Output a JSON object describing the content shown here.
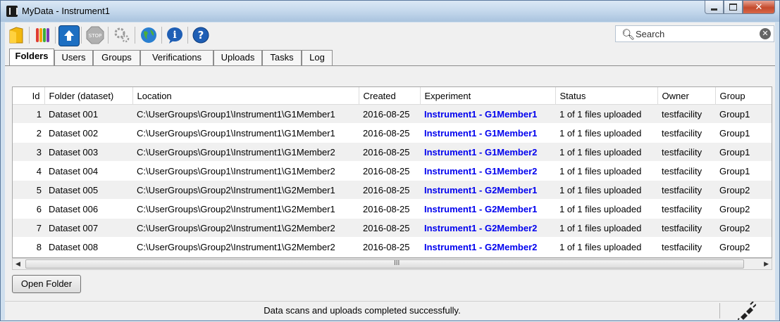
{
  "window": {
    "title": "MyData - Instrument1"
  },
  "toolbar": {
    "icons": [
      "folder-icon",
      "test-tubes-icon",
      "upload-icon",
      "stop-icon",
      "settings-gears-icon",
      "web-globe-icon",
      "info-icon",
      "help-icon"
    ],
    "search_placeholder": "Search"
  },
  "tabs": [
    {
      "label": "Folders",
      "active": true
    },
    {
      "label": "Users"
    },
    {
      "label": "Groups"
    },
    {
      "label": "Verifications"
    },
    {
      "label": "Uploads"
    },
    {
      "label": "Tasks"
    },
    {
      "label": "Log"
    }
  ],
  "table": {
    "columns": [
      "Id",
      "Folder (dataset)",
      "Location",
      "Created",
      "Experiment",
      "Status",
      "Owner",
      "Group"
    ],
    "rows": [
      [
        "1",
        "Dataset 001",
        "C:\\UserGroups\\Group1\\Instrument1\\G1Member1",
        "2016-08-25",
        "Instrument1 - G1Member1",
        "1 of 1 files uploaded",
        "testfacility",
        "Group1"
      ],
      [
        "2",
        "Dataset 002",
        "C:\\UserGroups\\Group1\\Instrument1\\G1Member1",
        "2016-08-25",
        "Instrument1 - G1Member1",
        "1 of 1 files uploaded",
        "testfacility",
        "Group1"
      ],
      [
        "3",
        "Dataset 003",
        "C:\\UserGroups\\Group1\\Instrument1\\G1Member2",
        "2016-08-25",
        "Instrument1 - G1Member2",
        "1 of 1 files uploaded",
        "testfacility",
        "Group1"
      ],
      [
        "4",
        "Dataset 004",
        "C:\\UserGroups\\Group1\\Instrument1\\G1Member2",
        "2016-08-25",
        "Instrument1 - G1Member2",
        "1 of 1 files uploaded",
        "testfacility",
        "Group1"
      ],
      [
        "5",
        "Dataset 005",
        "C:\\UserGroups\\Group2\\Instrument1\\G2Member1",
        "2016-08-25",
        "Instrument1 - G2Member1",
        "1 of 1 files uploaded",
        "testfacility",
        "Group2"
      ],
      [
        "6",
        "Dataset 006",
        "C:\\UserGroups\\Group2\\Instrument1\\G2Member1",
        "2016-08-25",
        "Instrument1 - G2Member1",
        "1 of 1 files uploaded",
        "testfacility",
        "Group2"
      ],
      [
        "7",
        "Dataset 007",
        "C:\\UserGroups\\Group2\\Instrument1\\G2Member2",
        "2016-08-25",
        "Instrument1 - G2Member2",
        "1 of 1 files uploaded",
        "testfacility",
        "Group2"
      ],
      [
        "8",
        "Dataset 008",
        "C:\\UserGroups\\Group2\\Instrument1\\G2Member2",
        "2016-08-25",
        "Instrument1 - G2Member2",
        "1 of 1 files uploaded",
        "testfacility",
        "Group2"
      ]
    ]
  },
  "buttons": {
    "open_folder": "Open Folder"
  },
  "scrollbar": {
    "grip": "III"
  },
  "status": {
    "message": "Data scans and uploads completed successfully.",
    "icon": "connection-plug-icon"
  },
  "colors": {
    "experiment_link": "#0000ee"
  }
}
